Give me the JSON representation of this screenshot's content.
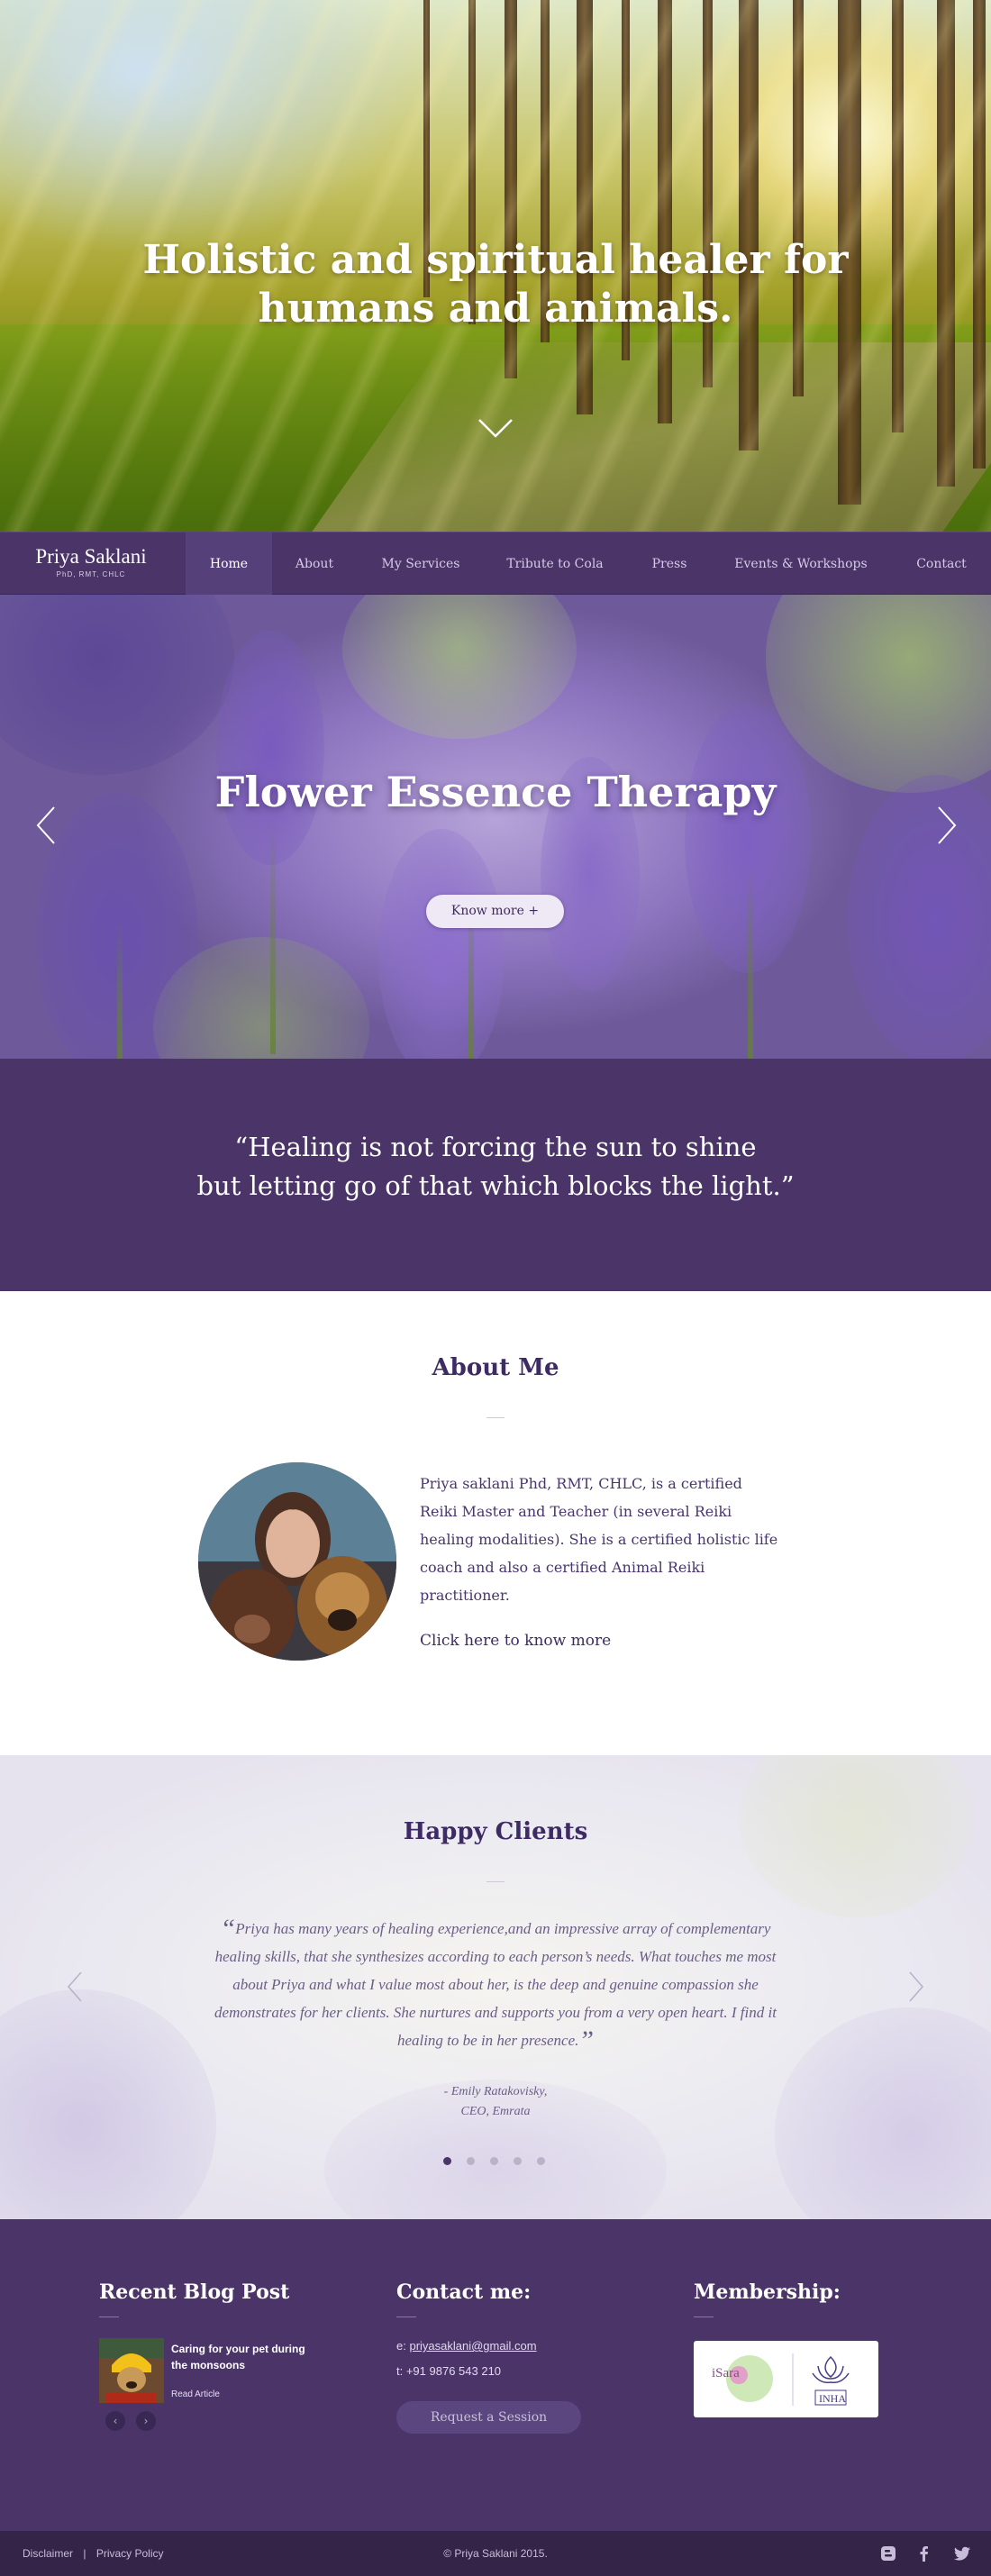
{
  "hero": {
    "title_line1": "Holistic and spiritual healer for",
    "title_line2": "humans and animals.",
    "scroll_icon": "chevron-down-icon"
  },
  "nav": {
    "brand_name": "Priya Saklani",
    "brand_sub": "PhD, RMT, CHLC",
    "items": [
      {
        "label": "Home",
        "active": true
      },
      {
        "label": "About",
        "active": false
      },
      {
        "label": "My Services",
        "active": false
      },
      {
        "label": "Tribute to Cola",
        "active": false
      },
      {
        "label": "Press",
        "active": false
      },
      {
        "label": "Events & Workshops",
        "active": false
      },
      {
        "label": "Contact",
        "active": false
      }
    ]
  },
  "slider": {
    "title": "Flower Essence Therapy",
    "button_label": "Know more +",
    "prev_icon": "chevron-left-icon",
    "next_icon": "chevron-right-icon"
  },
  "quote": {
    "line1": "“Healing is not forcing the sun to shine",
    "line2": "but letting go of that which blocks the light.”"
  },
  "about": {
    "title": "About Me",
    "text": "Priya saklani Phd, RMT, CHLC, is a certified Reiki Master and Teacher (in several Reiki healing modalities). She is a certified holistic life coach and also a certified Animal Reiki practitioner.",
    "link": "Click here to know more"
  },
  "clients": {
    "title": "Happy Clients",
    "open_quote": "“",
    "testimonial": "Priya has many years of healing experience,and an impressive array of complementary healing skills, that she synthesizes according to  each person’s needs. What touches me most about Priya and what I value most about her, is the deep and genuine compassion she demonstrates for her clients. She nurtures and supports you from a very open heart. I find it healing to be in her presence.",
    "close_quote": "”",
    "name": "- Emily Ratakovisky,",
    "role": "CEO, Emrata",
    "dot_count": 5,
    "active_dot": 1
  },
  "footer": {
    "blog": {
      "title": "Recent Blog Post",
      "post_title": "Caring for your pet during the monsoons",
      "read_label": "Read Article",
      "prev": "‹",
      "next": "›"
    },
    "contact": {
      "title": "Contact me:",
      "email_prefix": "e: ",
      "email": "priyasaklani@gmail.com",
      "phone": "t: +91 9876 543 210",
      "button_label": "Request a Session"
    },
    "membership": {
      "title": "Membership:",
      "logo1_text": "iSara",
      "logo2_text": "INHA"
    }
  },
  "bottom": {
    "disclaimer": "Disclaimer",
    "separator": "|",
    "privacy": "Privacy Policy",
    "copyright": "© Priya Saklani 2015.",
    "social_icons": [
      "blogger-icon",
      "facebook-icon",
      "twitter-icon"
    ]
  },
  "colors": {
    "primary_purple": "#4a3468",
    "dark_purple": "#332448",
    "accent_light": "#efe9f6"
  }
}
